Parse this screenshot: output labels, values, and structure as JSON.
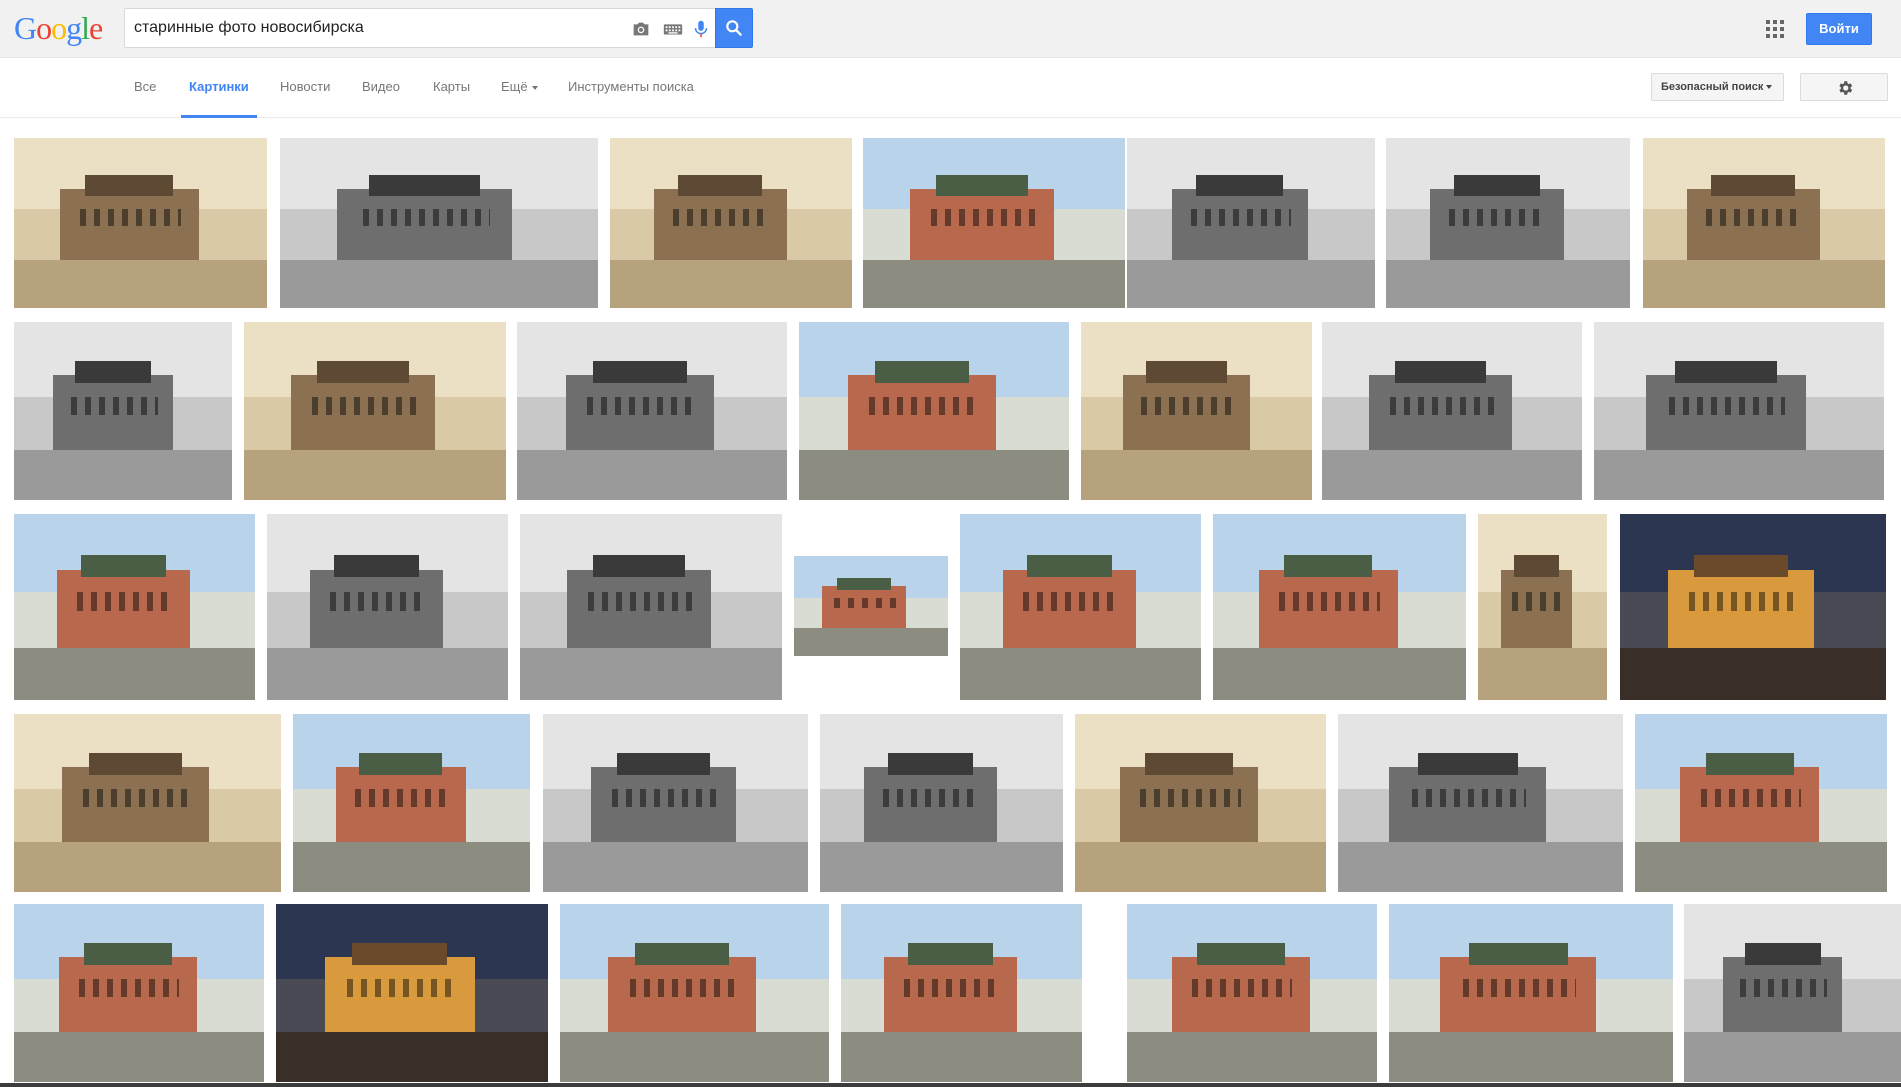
{
  "logo": {
    "letters": [
      "G",
      "o",
      "o",
      "g",
      "l",
      "e"
    ],
    "colors": [
      "#4285f4",
      "#ea4335",
      "#fbbc05",
      "#4285f4",
      "#34a853",
      "#ea4335"
    ]
  },
  "search": {
    "query": "старинные фото новосибирска"
  },
  "header": {
    "signin_label": "Войти"
  },
  "nav": {
    "tabs": [
      {
        "label": "Все"
      },
      {
        "label": "Картинки",
        "active": true
      },
      {
        "label": "Новости"
      },
      {
        "label": "Видео"
      },
      {
        "label": "Карты"
      },
      {
        "label": "Ещё"
      },
      {
        "label": "Инструменты поиска"
      }
    ],
    "safesearch_label": "Безопасный поиск"
  },
  "icons": {
    "camera": "camera-icon",
    "keyboard": "keyboard-icon",
    "mic": "microphone-icon",
    "search": "search-icon",
    "apps": "apps-grid-icon",
    "settings": "gear-icon"
  },
  "colors": {
    "accent": "#4285f4",
    "topbar_bg": "#f1f1f1"
  },
  "image_rows": [
    [
      "sepia",
      "bw",
      "sepia",
      "color",
      "bw",
      "bw",
      "sepia"
    ],
    [
      "bw",
      "sepia",
      "bw",
      "color",
      "sepia",
      "bw",
      "bw"
    ],
    [
      "color",
      "bw",
      "bw",
      "color",
      "color",
      "color",
      "sepia",
      "night"
    ],
    [
      "sepia",
      "color",
      "bw",
      "bw",
      "sepia",
      "bw",
      "color"
    ],
    [
      "color",
      "night",
      "color",
      "color",
      "color",
      "color",
      "bw"
    ]
  ]
}
